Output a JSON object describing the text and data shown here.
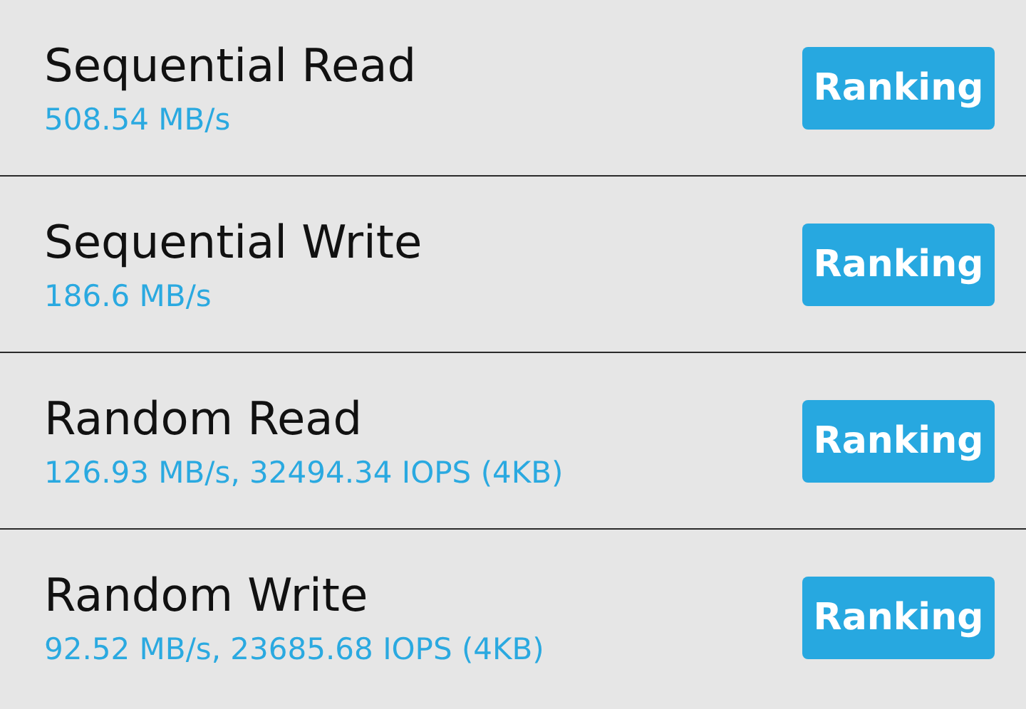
{
  "results": [
    {
      "title": "Sequential Read",
      "value": "508.54 MB/s",
      "button": "Ranking"
    },
    {
      "title": "Sequential Write",
      "value": "186.6 MB/s",
      "button": "Ranking"
    },
    {
      "title": "Random Read",
      "value": "126.93 MB/s, 32494.34 IOPS (4KB)",
      "button": "Ranking"
    },
    {
      "title": "Random Write",
      "value": "92.52 MB/s, 23685.68 IOPS (4KB)",
      "button": "Ranking"
    }
  ]
}
